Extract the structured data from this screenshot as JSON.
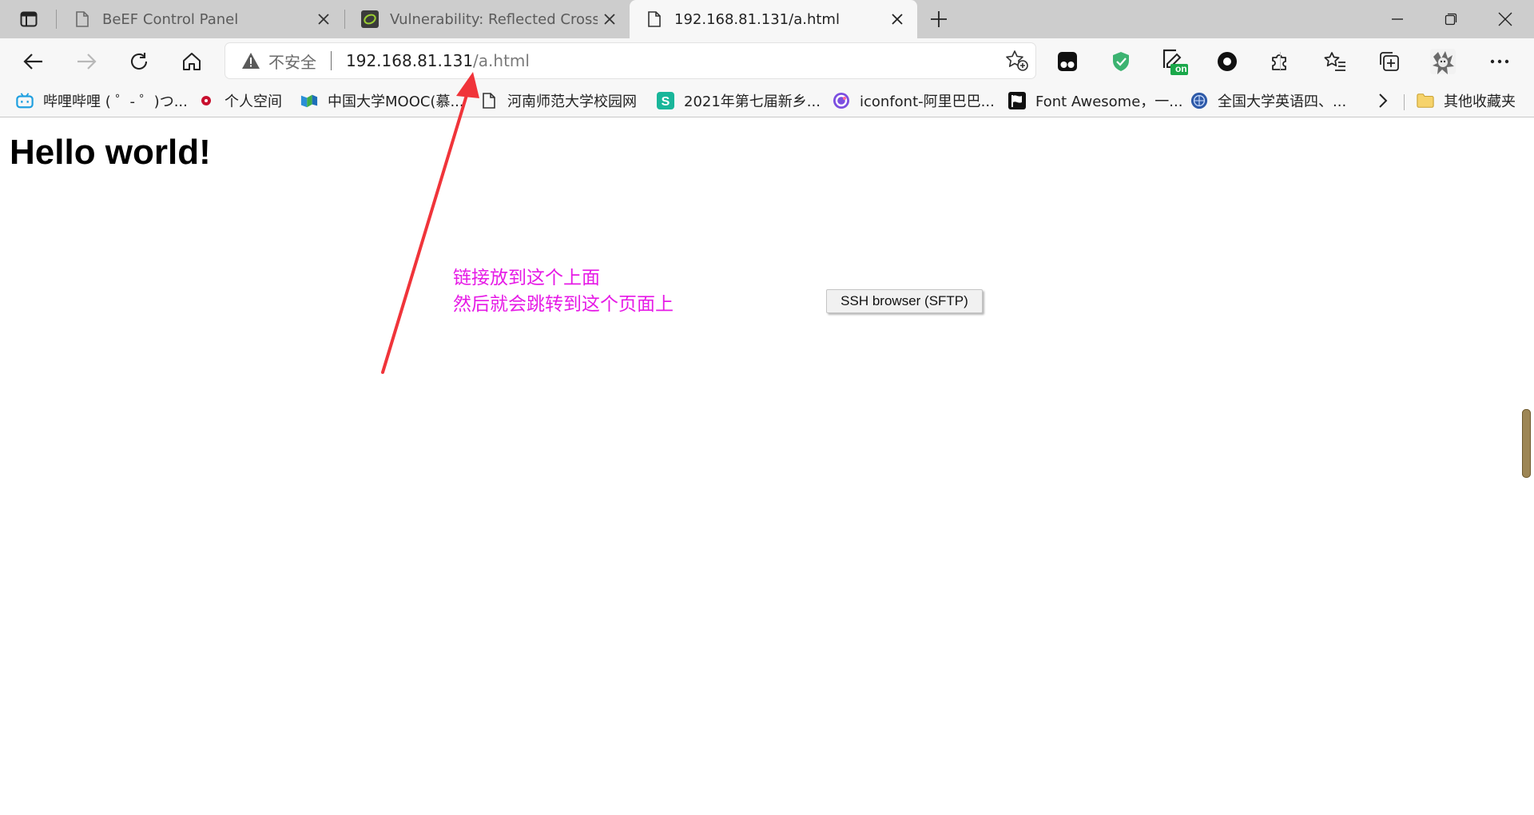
{
  "browser": {
    "tabs": [
      {
        "title": "BeEF Control Panel",
        "favicon": "page-icon",
        "active": false
      },
      {
        "title": "Vulnerability: Reflected Cross Site Scripting (XSS)",
        "favicon": "dvwa-icon",
        "active": false
      },
      {
        "title": "192.168.81.131/a.html",
        "favicon": "page-icon",
        "active": true
      }
    ],
    "address": {
      "security_label": "不安全",
      "url_host": "192.168.81.131",
      "url_path": "/a.html"
    },
    "extension_badge": "on",
    "bookmarks": [
      {
        "label": "哔哩哔哩 ( ゜- ゜)つ...",
        "icon": "bilibili-icon"
      },
      {
        "label": "个人空间",
        "icon": "ball-icon"
      },
      {
        "label": "中国大学MOOC(慕...",
        "icon": "mooc-icon"
      },
      {
        "label": "河南师范大学校园网",
        "icon": "page-icon"
      },
      {
        "label": "2021年第七届新乡...",
        "icon": "s-icon"
      },
      {
        "label": "iconfont-阿里巴巴...",
        "icon": "iconfont-icon"
      },
      {
        "label": "Font Awesome，一...",
        "icon": "flag-icon"
      },
      {
        "label": "全国大学英语四、...",
        "icon": "globe-icon"
      }
    ],
    "other_bookmarks": "其他收藏夹"
  },
  "page": {
    "heading": "Hello world!",
    "button_label": "SSH browser (SFTP)"
  },
  "annotation": {
    "line1": "链接放到这个上面",
    "line2": "然后就会跳转到这个页面上",
    "color": "#e61ae6",
    "arrow_color": "#f0343a"
  }
}
